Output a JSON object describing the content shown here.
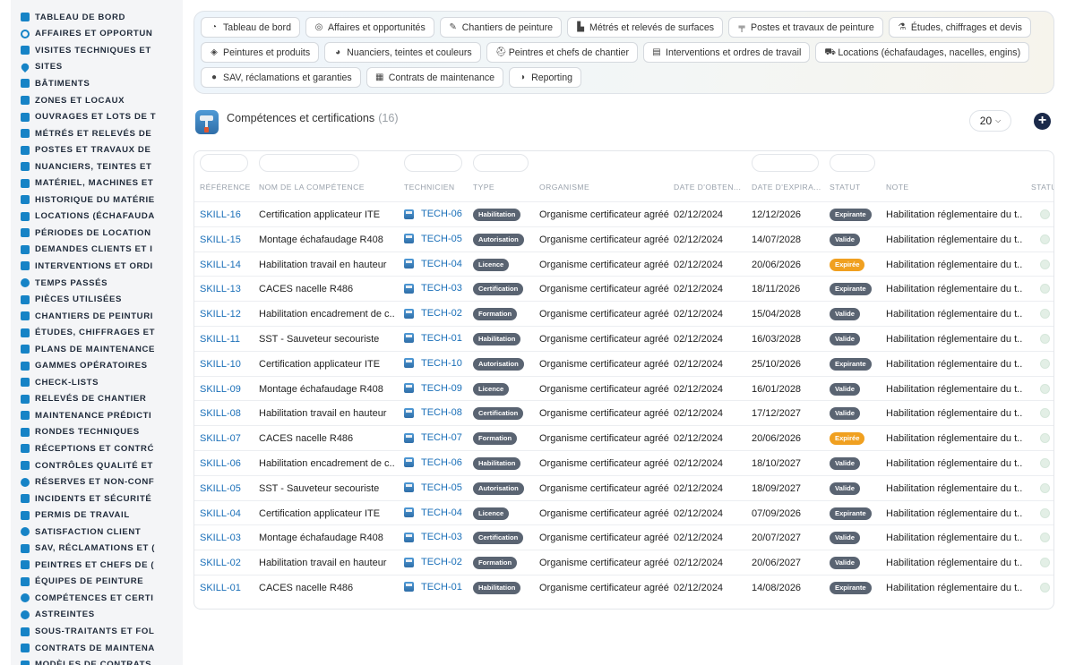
{
  "sidebar": {
    "items": [
      {
        "label": "TABLEAU DE BORD",
        "icon": "dashboard-icon"
      },
      {
        "label": "AFFAIRES ET OPPORTUN",
        "icon": "target-icon"
      },
      {
        "label": "VISITES TECHNIQUES ET",
        "icon": "clipboard-icon"
      },
      {
        "label": "SITES",
        "icon": "map-pin-icon"
      },
      {
        "label": "BÂTIMENTS",
        "icon": "building-icon"
      },
      {
        "label": "ZONES ET LOCAUX",
        "icon": "layers-icon"
      },
      {
        "label": "OUVRAGES ET LOTS DE T",
        "icon": "sitemap-icon"
      },
      {
        "label": "MÉTRÉS ET RELEVÉS DE",
        "icon": "ruler-icon"
      },
      {
        "label": "POSTES ET TRAVAUX DE",
        "icon": "paint-roller-icon"
      },
      {
        "label": "NUANCIERS, TEINTES ET",
        "icon": "palette-icon"
      },
      {
        "label": "MATÉRIEL, MACHINES ET",
        "icon": "gears-icon"
      },
      {
        "label": "HISTORIQUE DU MATÉRIE",
        "icon": "history-icon"
      },
      {
        "label": "LOCATIONS (ÉCHAFAUDA",
        "icon": "truck-icon"
      },
      {
        "label": "PÉRIODES DE LOCATION",
        "icon": "calendar-icon"
      },
      {
        "label": "DEMANDES CLIENTS ET I",
        "icon": "inbox-icon"
      },
      {
        "label": "INTERVENTIONS ET ORDI",
        "icon": "wrench-icon"
      },
      {
        "label": "TEMPS PASSÉS",
        "icon": "clock-icon"
      },
      {
        "label": "PIÈCES UTILISÉES",
        "icon": "box-icon"
      },
      {
        "label": "CHANTIERS DE PEINTURI",
        "icon": "brush-icon"
      },
      {
        "label": "ÉTUDES, CHIFFRAGES ET",
        "icon": "calculator-icon"
      },
      {
        "label": "PLANS DE MAINTENANCE",
        "icon": "calendar-check-icon"
      },
      {
        "label": "GAMMES OPÉRATOIRES",
        "icon": "list-icon"
      },
      {
        "label": "CHECK-LISTS",
        "icon": "checklist-icon"
      },
      {
        "label": "RELEVÉS DE CHANTIER",
        "icon": "clipboard-list-icon"
      },
      {
        "label": "MAINTENANCE PRÉDICTI",
        "icon": "chart-icon"
      },
      {
        "label": "RONDES TECHNIQUES",
        "icon": "route-icon"
      },
      {
        "label": "RÉCEPTIONS ET CONTRĆ",
        "icon": "search-icon"
      },
      {
        "label": "CONTRÔLES QUALITÉ ET",
        "icon": "clipboard-check-icon"
      },
      {
        "label": "RÉSERVES ET NON-CONF",
        "icon": "alert-circle-icon"
      },
      {
        "label": "INCIDENTS ET SÉCURITÉ",
        "icon": "warning-icon"
      },
      {
        "label": "PERMIS DE TRAVAIL",
        "icon": "file-signature-icon"
      },
      {
        "label": "SATISFACTION CLIENT",
        "icon": "smile-icon"
      },
      {
        "label": "SAV, RÉCLAMATIONS ET (",
        "icon": "comment-icon"
      },
      {
        "label": "PEINTRES ET CHEFS DE (",
        "icon": "comments-icon"
      },
      {
        "label": "ÉQUIPES DE PEINTURE",
        "icon": "users-icon"
      },
      {
        "label": "COMPÉTENCES ET CERTI",
        "icon": "certificate-icon"
      },
      {
        "label": "ASTREINTES",
        "icon": "user-clock-icon"
      },
      {
        "label": "SOUS-TRAITANTS ET FOL",
        "icon": "handshake-icon"
      },
      {
        "label": "CONTRATS DE MAINTENA",
        "icon": "file-contract-icon"
      },
      {
        "label": "MODÈLES DE CONTRATS",
        "icon": "file-icon"
      }
    ]
  },
  "topnav": {
    "rows": [
      [
        {
          "label": "Tableau de bord",
          "icon": "dashboard-icon",
          "glyph": "◔"
        },
        {
          "label": "Affaires et opportunités",
          "icon": "target-icon",
          "glyph": "◎"
        },
        {
          "label": "Chantiers de peinture",
          "icon": "brush-icon",
          "glyph": "✎"
        },
        {
          "label": "Métrés et relevés de surfaces",
          "icon": "ruler-icon",
          "glyph": "▙"
        },
        {
          "label": "Postes et travaux de peinture",
          "icon": "paint-roller-icon",
          "glyph": "╤"
        },
        {
          "label": "Études, chiffrages et devis",
          "icon": "calculator-icon",
          "glyph": "⚗"
        }
      ],
      [
        {
          "label": "Peintures et produits",
          "icon": "fill-icon",
          "glyph": "◈"
        },
        {
          "label": "Nuanciers, teintes et couleurs",
          "icon": "palette-icon",
          "glyph": "◕"
        },
        {
          "label": "Peintres et chefs de chantier",
          "icon": "helmet-icon",
          "glyph": "⛑"
        },
        {
          "label": "Interventions et ordres de travail",
          "icon": "clipboard-icon",
          "glyph": "▤"
        },
        {
          "label": "Locations (échafaudages, nacelles, engins)",
          "icon": "truck-icon",
          "glyph": "⛟"
        }
      ],
      [
        {
          "label": "SAV, réclamations et garanties",
          "icon": "comment-icon",
          "glyph": "●"
        },
        {
          "label": "Contrats de maintenance",
          "icon": "file-contract-icon",
          "glyph": "▦"
        },
        {
          "label": "Reporting",
          "icon": "chart-pie-icon",
          "glyph": "◑"
        }
      ]
    ]
  },
  "page": {
    "title": "Compétences et certifications",
    "count": "(16)",
    "page_size": "20",
    "add_label": "+"
  },
  "table": {
    "headers": {
      "reference": "RÉFÉRENCE",
      "name": "NOM DE LA COMPÉTENCE",
      "technician": "TECHNICIEN",
      "type": "TYPE",
      "organism": "ORGANISME",
      "obtained": "DATE D'OBTEN...",
      "expires": "DATE D'EXPIRA...",
      "status": "STATUT",
      "note": "NOTE",
      "status2": "STATU"
    },
    "badge_colors": {
      "Expirante": "#5a6472",
      "Valide": "#5a6472",
      "Expirée": "#f0a020"
    },
    "rows": [
      {
        "ref": "SKILL-16",
        "name": "Certification applicateur ITE",
        "tech": "TECH-06",
        "type": "Habilitation",
        "org": "Organisme certificateur agréé",
        "obtained": "02/12/2024",
        "expires": "12/12/2026",
        "status": "Expirante",
        "note": "Habilitation réglementaire du t..."
      },
      {
        "ref": "SKILL-15",
        "name": "Montage échafaudage R408",
        "tech": "TECH-05",
        "type": "Autorisation",
        "org": "Organisme certificateur agréé",
        "obtained": "02/12/2024",
        "expires": "14/07/2028",
        "status": "Valide",
        "note": "Habilitation réglementaire du t..."
      },
      {
        "ref": "SKILL-14",
        "name": "Habilitation travail en hauteur",
        "tech": "TECH-04",
        "type": "Licence",
        "org": "Organisme certificateur agréé",
        "obtained": "02/12/2024",
        "expires": "20/06/2026",
        "status": "Expirée",
        "note": "Habilitation réglementaire du t..."
      },
      {
        "ref": "SKILL-13",
        "name": "CACES nacelle R486",
        "tech": "TECH-03",
        "type": "Certification",
        "org": "Organisme certificateur agréé",
        "obtained": "02/12/2024",
        "expires": "18/11/2026",
        "status": "Expirante",
        "note": "Habilitation réglementaire du t..."
      },
      {
        "ref": "SKILL-12",
        "name": "Habilitation encadrement de c...",
        "tech": "TECH-02",
        "type": "Formation",
        "org": "Organisme certificateur agréé",
        "obtained": "02/12/2024",
        "expires": "15/04/2028",
        "status": "Valide",
        "note": "Habilitation réglementaire du t..."
      },
      {
        "ref": "SKILL-11",
        "name": "SST - Sauveteur secouriste",
        "tech": "TECH-01",
        "type": "Habilitation",
        "org": "Organisme certificateur agréé",
        "obtained": "02/12/2024",
        "expires": "16/03/2028",
        "status": "Valide",
        "note": "Habilitation réglementaire du t..."
      },
      {
        "ref": "SKILL-10",
        "name": "Certification applicateur ITE",
        "tech": "TECH-10",
        "type": "Autorisation",
        "org": "Organisme certificateur agréé",
        "obtained": "02/12/2024",
        "expires": "25/10/2026",
        "status": "Expirante",
        "note": "Habilitation réglementaire du t..."
      },
      {
        "ref": "SKILL-09",
        "name": "Montage échafaudage R408",
        "tech": "TECH-09",
        "type": "Licence",
        "org": "Organisme certificateur agréé",
        "obtained": "02/12/2024",
        "expires": "16/01/2028",
        "status": "Valide",
        "note": "Habilitation réglementaire du t..."
      },
      {
        "ref": "SKILL-08",
        "name": "Habilitation travail en hauteur",
        "tech": "TECH-08",
        "type": "Certification",
        "org": "Organisme certificateur agréé",
        "obtained": "02/12/2024",
        "expires": "17/12/2027",
        "status": "Valide",
        "note": "Habilitation réglementaire du t..."
      },
      {
        "ref": "SKILL-07",
        "name": "CACES nacelle R486",
        "tech": "TECH-07",
        "type": "Formation",
        "org": "Organisme certificateur agréé",
        "obtained": "02/12/2024",
        "expires": "20/06/2026",
        "status": "Expirée",
        "note": "Habilitation réglementaire du t..."
      },
      {
        "ref": "SKILL-06",
        "name": "Habilitation encadrement de c...",
        "tech": "TECH-06",
        "type": "Habilitation",
        "org": "Organisme certificateur agréé",
        "obtained": "02/12/2024",
        "expires": "18/10/2027",
        "status": "Valide",
        "note": "Habilitation réglementaire du t..."
      },
      {
        "ref": "SKILL-05",
        "name": "SST - Sauveteur secouriste",
        "tech": "TECH-05",
        "type": "Autorisation",
        "org": "Organisme certificateur agréé",
        "obtained": "02/12/2024",
        "expires": "18/09/2027",
        "status": "Valide",
        "note": "Habilitation réglementaire du t..."
      },
      {
        "ref": "SKILL-04",
        "name": "Certification applicateur ITE",
        "tech": "TECH-04",
        "type": "Licence",
        "org": "Organisme certificateur agréé",
        "obtained": "02/12/2024",
        "expires": "07/09/2026",
        "status": "Expirante",
        "note": "Habilitation réglementaire du t..."
      },
      {
        "ref": "SKILL-03",
        "name": "Montage échafaudage R408",
        "tech": "TECH-03",
        "type": "Certification",
        "org": "Organisme certificateur agréé",
        "obtained": "02/12/2024",
        "expires": "20/07/2027",
        "status": "Valide",
        "note": "Habilitation réglementaire du t..."
      },
      {
        "ref": "SKILL-02",
        "name": "Habilitation travail en hauteur",
        "tech": "TECH-02",
        "type": "Formation",
        "org": "Organisme certificateur agréé",
        "obtained": "02/12/2024",
        "expires": "20/06/2027",
        "status": "Valide",
        "note": "Habilitation réglementaire du t..."
      },
      {
        "ref": "SKILL-01",
        "name": "CACES nacelle R486",
        "tech": "TECH-01",
        "type": "Habilitation",
        "org": "Organisme certificateur agréé",
        "obtained": "02/12/2024",
        "expires": "14/08/2026",
        "status": "Expirante",
        "note": "Habilitation réglementaire du t..."
      }
    ]
  }
}
